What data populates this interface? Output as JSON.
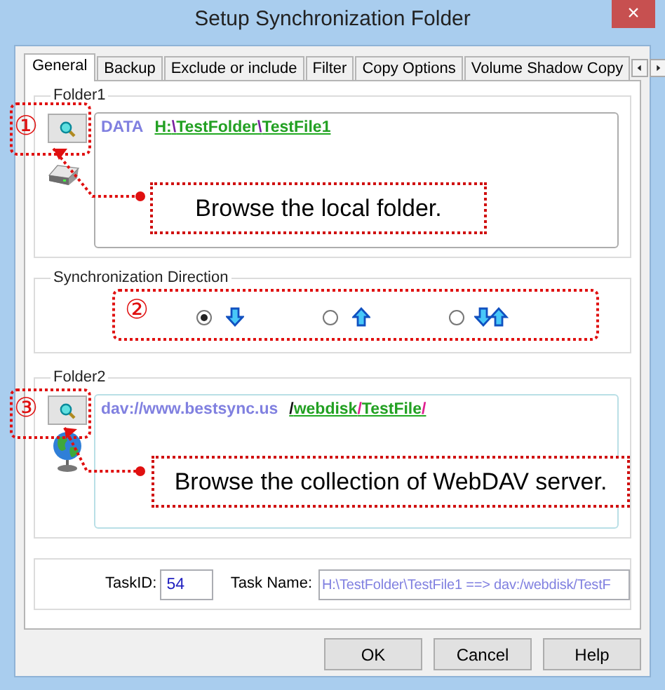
{
  "window": {
    "title": "Setup Synchronization Folder",
    "close": "×"
  },
  "tabs": [
    {
      "label": "General",
      "selected": true
    },
    {
      "label": "Backup",
      "selected": false
    },
    {
      "label": "Exclude or include",
      "selected": false
    },
    {
      "label": "Filter",
      "selected": false
    },
    {
      "label": "Copy Options",
      "selected": false
    },
    {
      "label": "Volume Shadow Copy",
      "selected": false
    }
  ],
  "folder1": {
    "legend": "Folder1",
    "label": "DATA",
    "segments": [
      {
        "text": "H:",
        "kind": "name"
      },
      {
        "text": "\\",
        "kind": "separator"
      },
      {
        "text": "TestFolder",
        "kind": "name"
      },
      {
        "text": "\\",
        "kind": "separator"
      },
      {
        "text": "TestFile1",
        "kind": "name"
      }
    ]
  },
  "direction": {
    "legend": "Synchronization Direction",
    "options": [
      {
        "kind": "down",
        "selected": true
      },
      {
        "kind": "up",
        "selected": false
      },
      {
        "kind": "both",
        "selected": false
      }
    ]
  },
  "folder2": {
    "legend": "Folder2",
    "label": "dav://www.bestsync.us",
    "segments": [
      {
        "text": "/",
        "kind": "root"
      },
      {
        "text": "webdisk",
        "kind": "name"
      },
      {
        "text": "/",
        "kind": "separator"
      },
      {
        "text": "TestFile",
        "kind": "name"
      },
      {
        "text": "/",
        "kind": "separator"
      }
    ]
  },
  "task": {
    "id_label": "TaskID:",
    "id": "54",
    "name_label": "Task Name:",
    "name": "H:\\TestFolder\\TestFile1 ==> dav:/webdisk/TestF"
  },
  "buttons": [
    "OK",
    "Cancel",
    "Help"
  ],
  "annotations": [
    {
      "marker": "①",
      "callout": "Browse the local folder."
    },
    {
      "marker": "②"
    },
    {
      "marker": "③",
      "callout": "Browse the collection of WebDAV server."
    }
  ]
}
